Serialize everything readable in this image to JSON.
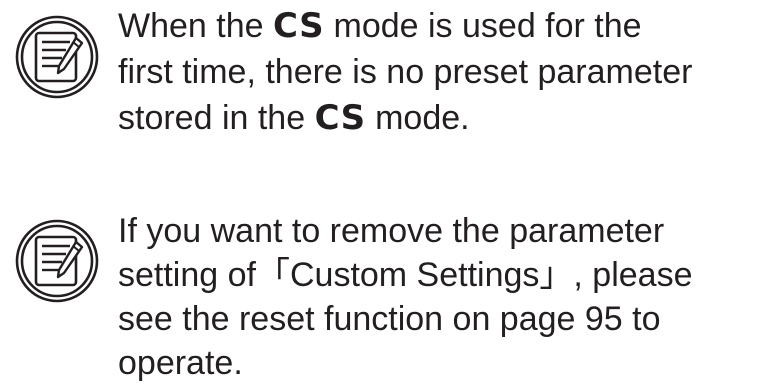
{
  "icons": {
    "note_icon": "note-pad-pencil-icon"
  },
  "notes": [
    {
      "line1_before": "When the ",
      "line1_cs": "CS",
      "line1_after": " mode is used for the",
      "line2": "first time, there is no preset parameter",
      "line3_before": "stored in the ",
      "line3_cs": "CS",
      "line3_after": " mode."
    },
    {
      "line1": "If you want to remove the parameter",
      "line2": "setting of「Custom Settings」, please",
      "line3": "see the reset function on page 95 to",
      "line4": "operate."
    }
  ],
  "colors": {
    "text": "#231f20",
    "icon_stroke": "#231f20"
  }
}
